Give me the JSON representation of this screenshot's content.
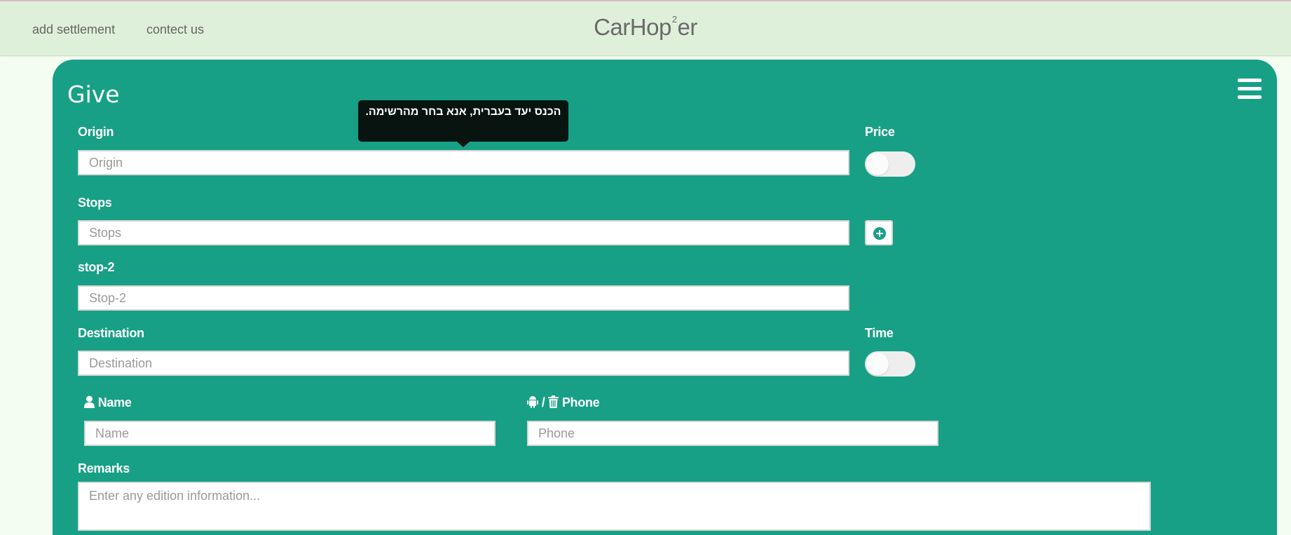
{
  "nav": {
    "add_settlement": "add settlement",
    "contact_us": "contect us",
    "brand_prefix": "CarHop",
    "brand_sup": "2",
    "brand_suffix": "er"
  },
  "panel": {
    "title": "Give",
    "menu_icon": "hamburger-menu-icon"
  },
  "tooltip": {
    "text": "הכנס יעד בעברית, אנא בחר מהרשימה."
  },
  "form": {
    "origin": {
      "label": "Origin",
      "placeholder": "Origin",
      "value": ""
    },
    "price": {
      "label": "Price",
      "enabled": false
    },
    "stops": {
      "label": "Stops",
      "placeholder": "Stops",
      "value": ""
    },
    "add_stop_icon": "plus-circle-icon",
    "stop2": {
      "label": "stop-2",
      "placeholder": "Stop-2",
      "value": ""
    },
    "destination": {
      "label": "Destination",
      "placeholder": "Destination",
      "value": ""
    },
    "time": {
      "label": "Time",
      "enabled": false
    },
    "name": {
      "label": "Name",
      "icon": "user-icon",
      "placeholder": "Name",
      "value": ""
    },
    "phone": {
      "label": "Phone",
      "icons": [
        "android-icon",
        "trash-icon"
      ],
      "separator": "/",
      "placeholder": "Phone",
      "value": ""
    },
    "remarks": {
      "label": "Remarks",
      "placeholder": "Enter any edition information...",
      "value": ""
    }
  },
  "colors": {
    "panel": "#17a085",
    "topbar": "#dff0da",
    "background": "#f3fdf0",
    "tooltip": "#081410"
  }
}
